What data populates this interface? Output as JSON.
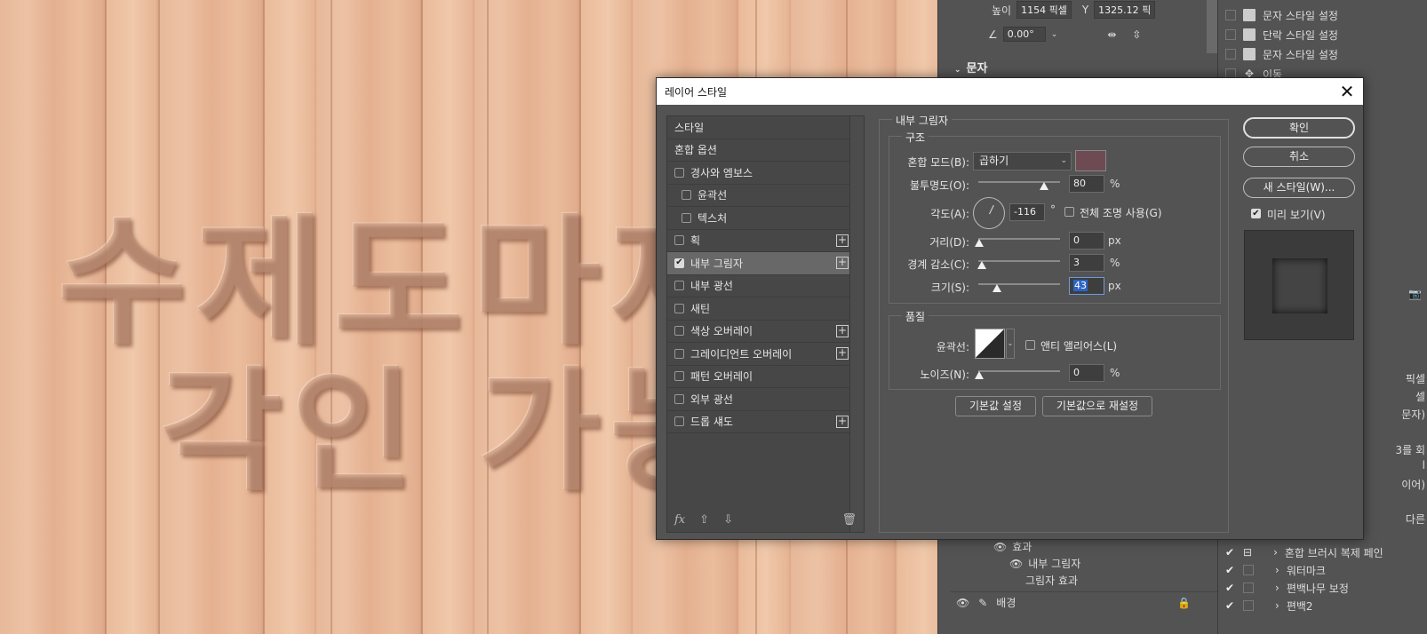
{
  "canvas": {
    "engraved_line1": "수제도마제",
    "engraved_line2": "각인 가능"
  },
  "properties": {
    "height_label": "높이",
    "height_value": "1154 픽셀",
    "y_label": "Y",
    "y_value": "1325.12 픽",
    "angle_value": "0.00°",
    "section_label": "문자",
    "layers": {
      "effects": "효과",
      "inner_shadow": "내부 그림자",
      "shadow_effect": "그림자 효과",
      "background": "배경"
    }
  },
  "history": {
    "items": [
      "문자 스타일 설정",
      "단락 스타일 설정",
      "문자 스타일 설정",
      "이동"
    ],
    "layer_rows": [
      "혼합 브러시 복제 페인",
      "워터마크",
      "편백나무 보정",
      "편백2"
    ],
    "fragments": [
      "픽셀",
      "셀",
      "문자)",
      "3를 회",
      "l",
      "이어)",
      "다른"
    ]
  },
  "dialog": {
    "title": "레이어 스타일",
    "close": "✕",
    "style_list": [
      {
        "label": "스타일",
        "type": "header"
      },
      {
        "label": "혼합 옵션",
        "type": "header"
      },
      {
        "label": "경사와 엠보스",
        "type": "check",
        "checked": false
      },
      {
        "label": "윤곽선",
        "type": "check",
        "checked": false,
        "indent": true
      },
      {
        "label": "텍스처",
        "type": "check",
        "checked": false,
        "indent": true
      },
      {
        "label": "획",
        "type": "check",
        "checked": false,
        "plus": true
      },
      {
        "label": "내부 그림자",
        "type": "check",
        "checked": true,
        "plus": true,
        "selected": true
      },
      {
        "label": "내부 광선",
        "type": "check",
        "checked": false
      },
      {
        "label": "새틴",
        "type": "check",
        "checked": false
      },
      {
        "label": "색상 오버레이",
        "type": "check",
        "checked": false,
        "plus": true
      },
      {
        "label": "그레이디언트 오버레이",
        "type": "check",
        "checked": false,
        "plus": true
      },
      {
        "label": "패턴 오버레이",
        "type": "check",
        "checked": false
      },
      {
        "label": "외부 광선",
        "type": "check",
        "checked": false
      },
      {
        "label": "드롭 섀도",
        "type": "check",
        "checked": false,
        "plus": true
      }
    ],
    "footer": {
      "fx": "fx",
      "up": "⇧",
      "down": "⇩",
      "trash": "🗑"
    },
    "panel_title": "내부 그림자",
    "structure": {
      "legend": "구조",
      "blend_mode_label": "혼합 모드(B):",
      "blend_mode_value": "곱하기",
      "blend_color": "#6e4b52",
      "opacity_label": "불투명도(O):",
      "opacity_value": "80",
      "opacity_unit": "%",
      "opacity_fraction": 0.8,
      "angle_label": "각도(A):",
      "angle_value": "-116",
      "angle_unit": "°",
      "global_light_label": "전체 조명 사용(G)",
      "distance_label": "거리(D):",
      "distance_value": "0",
      "distance_unit": "px",
      "choke_label": "경계 감소(C):",
      "choke_value": "3",
      "choke_unit": "%",
      "size_label": "크기(S):",
      "size_value": "43",
      "size_unit": "px"
    },
    "quality": {
      "legend": "품질",
      "contour_label": "윤곽선:",
      "antialias_label": "앤티 앨리어스(L)",
      "noise_label": "노이즈(N):",
      "noise_value": "0",
      "noise_unit": "%"
    },
    "buttons": {
      "make_default": "기본값 설정",
      "reset_default": "기본값으로 재설정",
      "ok": "확인",
      "cancel": "취소",
      "new_style": "새 스타일(W)...",
      "preview": "미리 보기(V)"
    }
  }
}
